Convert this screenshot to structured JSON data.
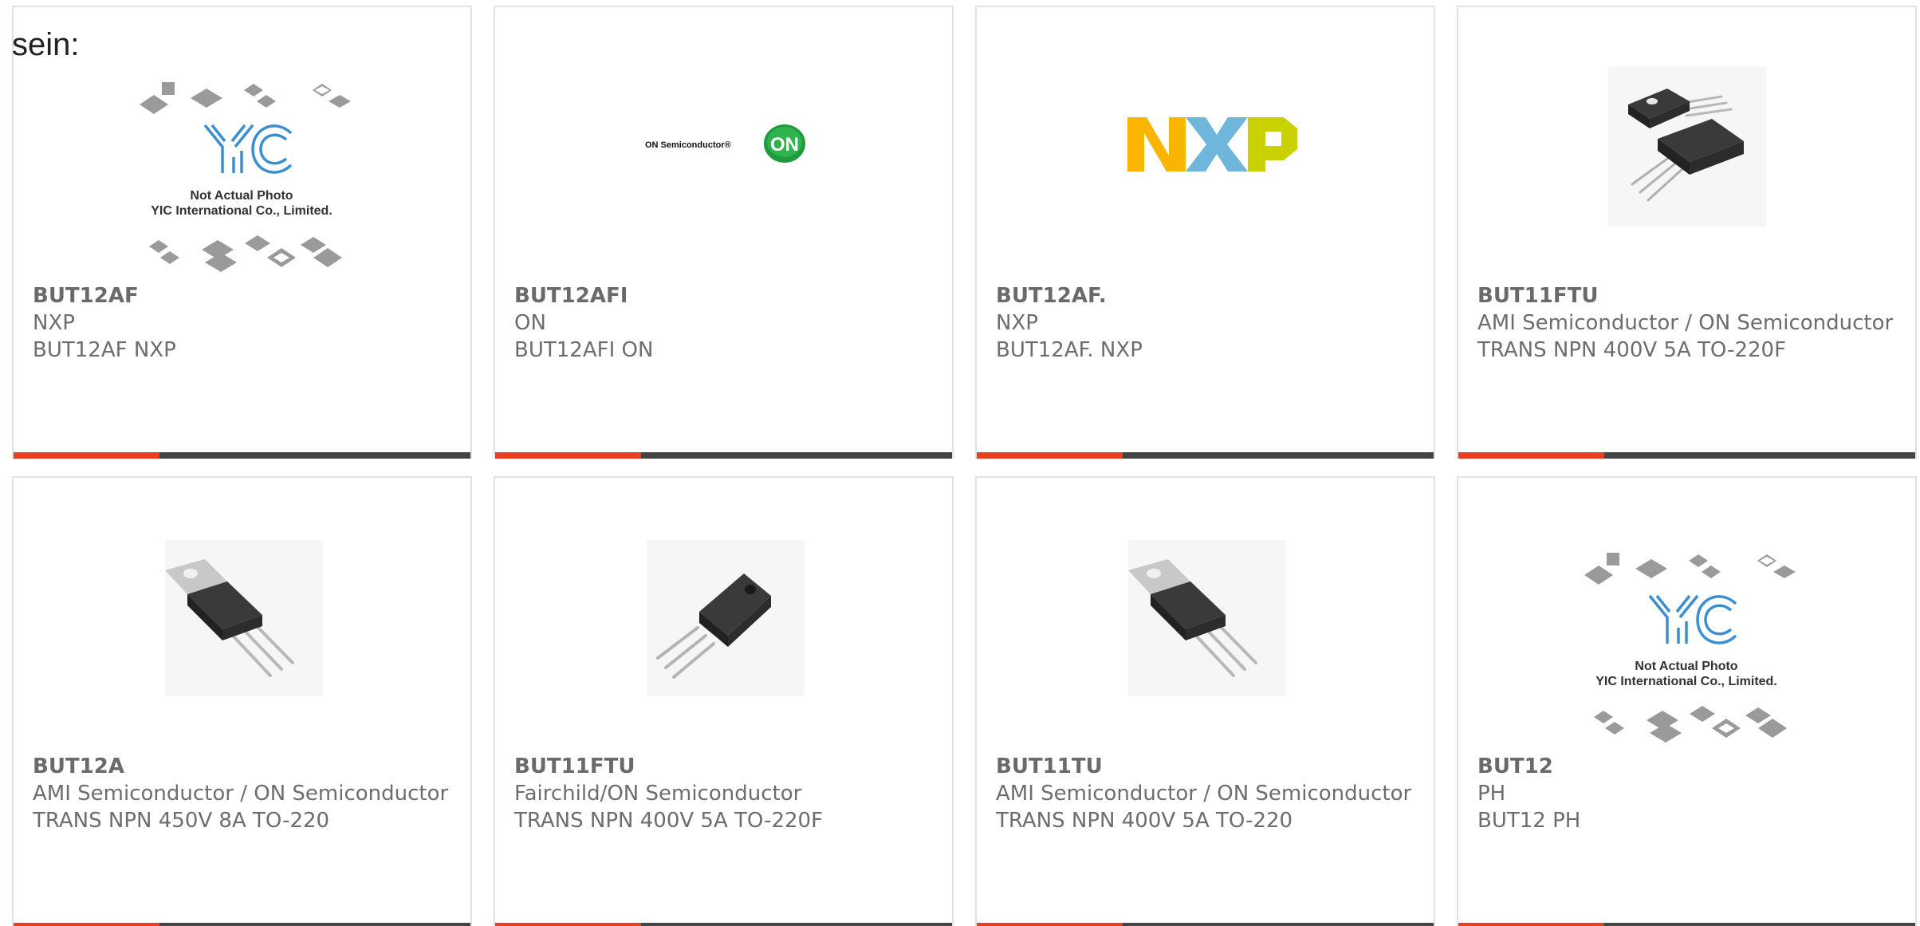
{
  "intro_text": "sein:",
  "colors": {
    "accent": "#e8401c",
    "bar": "#444444",
    "border": "#e2e2e2",
    "text": "#6d6d6d"
  },
  "cards": [
    {
      "part": "BUT12AF",
      "brand": "NXP",
      "description": "BUT12AF NXP",
      "image": "yic-placeholder-photo",
      "image_caption_1": "Not Actual Photo",
      "image_caption_2": "YIC International Co., Limited.",
      "logo_text": "YIC"
    },
    {
      "part": "BUT12AFI",
      "brand": "ON",
      "description": "BUT12AFI ON",
      "image": "on-semiconductor-logo",
      "logo_text": "ON Semiconductor®",
      "badge_text": "ON"
    },
    {
      "part": "BUT12AF.",
      "brand": "NXP",
      "description": "BUT12AF. NXP",
      "image": "nxp-logo",
      "logo_text": "NXP"
    },
    {
      "part": "BUT11FTU",
      "brand": "AMI Semiconductor / ON Semiconductor",
      "description": "TRANS NPN 400V 5A TO-220F",
      "image": "to-220f-package-photo"
    },
    {
      "part": "BUT12A",
      "brand": "AMI Semiconductor / ON Semiconductor",
      "description": "TRANS NPN 450V 8A TO-220",
      "image": "to-220-package-photo"
    },
    {
      "part": "BUT11FTU",
      "brand": "Fairchild/ON Semiconductor",
      "description": "TRANS NPN 400V 5A TO-220F",
      "image": "to-220f-package-photo"
    },
    {
      "part": "BUT11TU",
      "brand": "AMI Semiconductor / ON Semiconductor",
      "description": "TRANS NPN 400V 5A TO-220",
      "image": "to-220-package-photo"
    },
    {
      "part": "BUT12",
      "brand": "PH",
      "description": "BUT12 PH",
      "image": "yic-placeholder-photo",
      "image_caption_1": "Not Actual Photo",
      "image_caption_2": "YIC International Co., Limited.",
      "logo_text": "YIC"
    }
  ]
}
